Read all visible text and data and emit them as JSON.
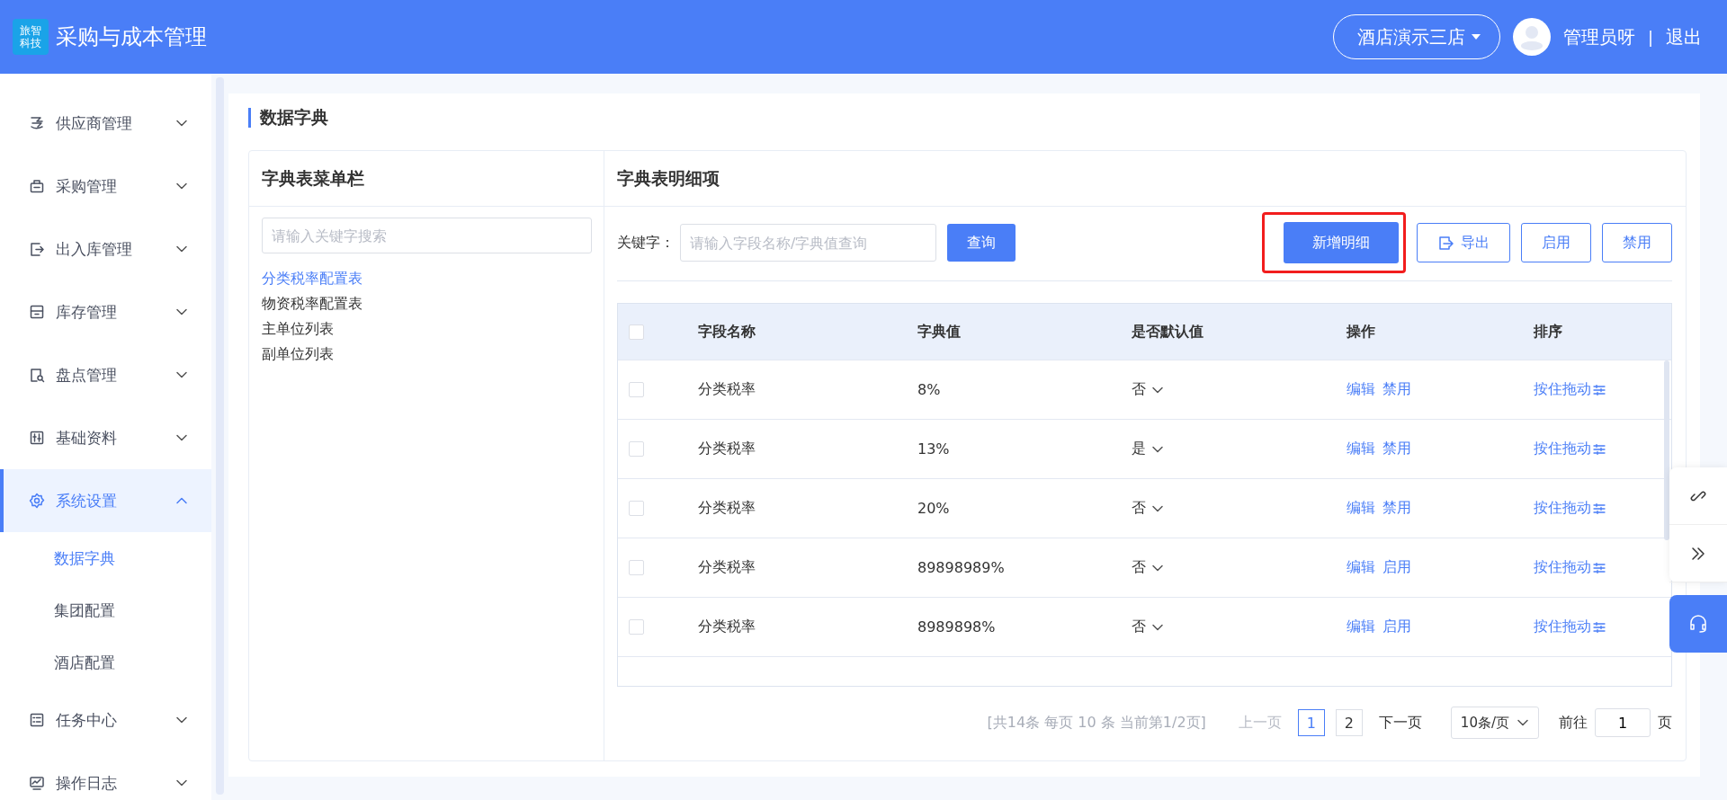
{
  "header": {
    "logo_lines": [
      "旅智",
      "科技"
    ],
    "title": "采购与成本管理",
    "store_selector": "酒店演示三店",
    "user_name": "管理员呀",
    "separator": "|",
    "logout": "退出"
  },
  "sidebar": {
    "items": [
      {
        "label": "供应商管理",
        "expanded": false,
        "selected": false
      },
      {
        "label": "采购管理",
        "expanded": false,
        "selected": false
      },
      {
        "label": "出入库管理",
        "expanded": false,
        "selected": false
      },
      {
        "label": "库存管理",
        "expanded": false,
        "selected": false
      },
      {
        "label": "盘点管理",
        "expanded": false,
        "selected": false
      },
      {
        "label": "基础资料",
        "expanded": false,
        "selected": false
      },
      {
        "label": "系统设置",
        "expanded": true,
        "selected": true,
        "children": [
          {
            "label": "数据字典",
            "selected": true
          },
          {
            "label": "集团配置",
            "selected": false
          },
          {
            "label": "酒店配置",
            "selected": false
          }
        ]
      },
      {
        "label": "任务中心",
        "expanded": false,
        "selected": false
      },
      {
        "label": "操作日志",
        "expanded": false,
        "selected": false
      }
    ]
  },
  "page_title": "数据字典",
  "dict_menu": {
    "title": "字典表菜单栏",
    "search": {
      "placeholder": "请输入关键字搜索"
    },
    "items": [
      {
        "label": "分类税率配置表",
        "selected": true
      },
      {
        "label": "物资税率配置表",
        "selected": false
      },
      {
        "label": "主单位列表",
        "selected": false
      },
      {
        "label": "副单位列表",
        "selected": false
      }
    ]
  },
  "detail": {
    "title": "字典表明细项",
    "keyword_label": "关键字：",
    "keyword_field": {
      "placeholder": "请输入字段名称/字典值查询"
    },
    "query_button": "查询",
    "buttons": [
      {
        "label": "新增明细",
        "kind": "primary",
        "highlighted": true
      },
      {
        "label": "导出",
        "kind": "export",
        "highlighted": false
      },
      {
        "label": "启用",
        "kind": "plain",
        "highlighted": false
      },
      {
        "label": "禁用",
        "kind": "plain",
        "highlighted": false
      }
    ],
    "table": {
      "select_all": {
        "checked": false
      },
      "columns": [
        "字段名称",
        "字典值",
        "是否默认值",
        "操作",
        "排序"
      ],
      "rows": [
        {
          "checked": false,
          "field_name": "分类税率",
          "value": "8%",
          "default": "否",
          "actions": [
            "编辑",
            "禁用"
          ],
          "sort": "按住拖动"
        },
        {
          "checked": false,
          "field_name": "分类税率",
          "value": "13%",
          "default": "是",
          "actions": [
            "编辑",
            "禁用"
          ],
          "sort": "按住拖动"
        },
        {
          "checked": false,
          "field_name": "分类税率",
          "value": "20%",
          "default": "否",
          "actions": [
            "编辑",
            "禁用"
          ],
          "sort": "按住拖动"
        },
        {
          "checked": false,
          "field_name": "分类税率",
          "value": "89898989%",
          "default": "否",
          "actions": [
            "编辑",
            "启用"
          ],
          "sort": "按住拖动"
        },
        {
          "checked": false,
          "field_name": "分类税率",
          "value": "8989898%",
          "default": "否",
          "actions": [
            "编辑",
            "启用"
          ],
          "sort": "按住拖动"
        }
      ]
    },
    "pagination": {
      "summary": "[共14条 每页 10 条 当前第1/2页]",
      "prev": {
        "label": "上一页",
        "disabled": true
      },
      "pages": [
        {
          "label": "1",
          "selected": true
        },
        {
          "label": "2",
          "selected": false
        }
      ],
      "next": {
        "label": "下一页",
        "disabled": false
      },
      "page_size": "10条/页",
      "goto_label": "前往",
      "goto_value": "1",
      "page_suffix": "页"
    }
  }
}
